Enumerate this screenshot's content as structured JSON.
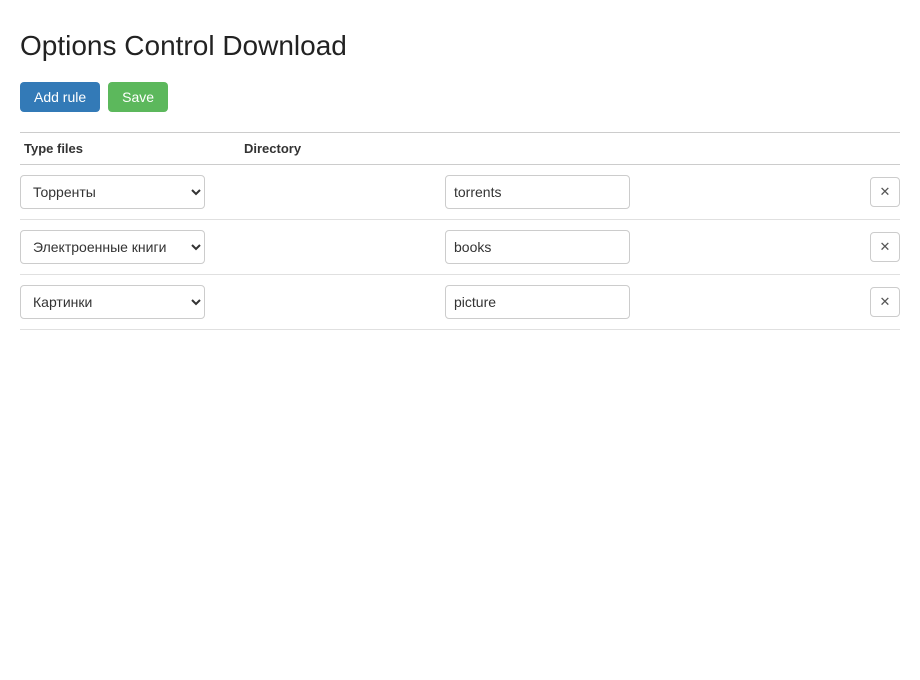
{
  "page": {
    "title": "Options Control Download"
  },
  "toolbar": {
    "add_label": "Add rule",
    "save_label": "Save"
  },
  "table": {
    "col_type_label": "Type files",
    "col_dir_label": "Directory"
  },
  "rules": [
    {
      "id": 1,
      "type_value": "Торренты",
      "type_options": [
        "Торренты",
        "Электроенные книги",
        "Картинки"
      ],
      "directory": "torrents"
    },
    {
      "id": 2,
      "type_value": "Электроенные книги",
      "type_options": [
        "Торренты",
        "Электроенные книги",
        "Картинки"
      ],
      "directory": "books"
    },
    {
      "id": 3,
      "type_value": "Картинки",
      "type_options": [
        "Торренты",
        "Электроенные книги",
        "Картинки"
      ],
      "directory": "picture"
    }
  ],
  "icons": {
    "delete": "✕",
    "up_down": "⇅"
  }
}
